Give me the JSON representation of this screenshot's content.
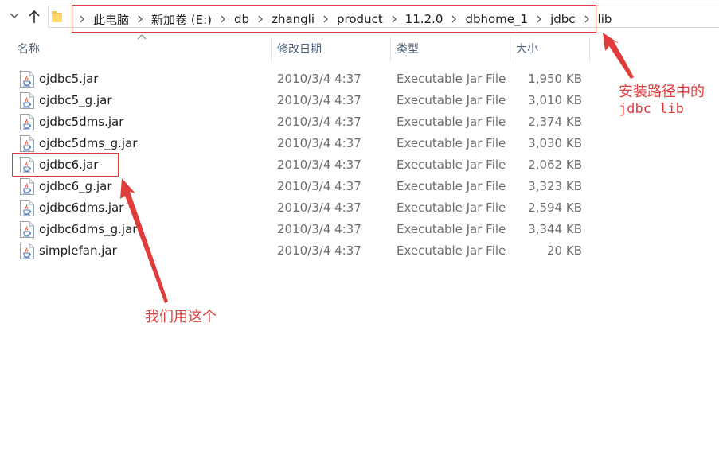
{
  "breadcrumb": [
    "此电脑",
    "新加卷 (E:)",
    "db",
    "zhangli",
    "product",
    "11.2.0",
    "dbhome_1",
    "jdbc",
    "lib"
  ],
  "columns": {
    "name": "名称",
    "date": "修改日期",
    "type": "类型",
    "size": "大小"
  },
  "files": [
    {
      "name": "ojdbc5.jar",
      "date": "2010/3/4 4:37",
      "type": "Executable Jar File",
      "size": "1,950 KB"
    },
    {
      "name": "ojdbc5_g.jar",
      "date": "2010/3/4 4:37",
      "type": "Executable Jar File",
      "size": "3,010 KB"
    },
    {
      "name": "ojdbc5dms.jar",
      "date": "2010/3/4 4:37",
      "type": "Executable Jar File",
      "size": "2,374 KB"
    },
    {
      "name": "ojdbc5dms_g.jar",
      "date": "2010/3/4 4:37",
      "type": "Executable Jar File",
      "size": "3,030 KB"
    },
    {
      "name": "ojdbc6.jar",
      "date": "2010/3/4 4:37",
      "type": "Executable Jar File",
      "size": "2,062 KB"
    },
    {
      "name": "ojdbc6_g.jar",
      "date": "2010/3/4 4:37",
      "type": "Executable Jar File",
      "size": "3,323 KB"
    },
    {
      "name": "ojdbc6dms.jar",
      "date": "2010/3/4 4:37",
      "type": "Executable Jar File",
      "size": "2,594 KB"
    },
    {
      "name": "ojdbc6dms_g.jar",
      "date": "2010/3/4 4:37",
      "type": "Executable Jar File",
      "size": "3,344 KB"
    },
    {
      "name": "simplefan.jar",
      "date": "2010/3/4 4:37",
      "type": "Executable Jar File",
      "size": "20 KB"
    }
  ],
  "annotations": {
    "path_note_line1": "安装路径中的",
    "path_note_line2": "jdbc lib",
    "file_note": "我们用这个"
  },
  "colors": {
    "annotation": "#e03c3c",
    "header_text": "#4c607a",
    "muted_text": "#6d6d6d",
    "folder": "#f3c34b"
  },
  "icons": {
    "nav_back": "chevron-down-icon",
    "nav_up": "arrow-up-icon",
    "location": "folder-icon",
    "separator": "chevron-right-icon",
    "file": "jar-file-icon",
    "sort": "sort-caret-icon"
  }
}
